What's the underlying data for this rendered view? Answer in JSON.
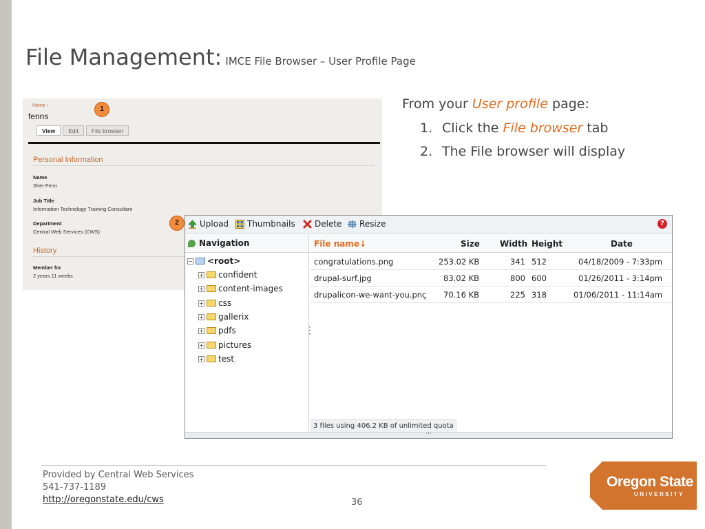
{
  "slide": {
    "title": "File Management:",
    "subtitle": "IMCE File Browser – User Profile Page",
    "page_number": "36"
  },
  "profile": {
    "breadcrumb": "Home ›",
    "username": "fenns",
    "tabs": [
      "View",
      "Edit",
      "File browser"
    ],
    "personal_heading": "Personal Information",
    "name_label": "Name",
    "name_value": "Sher Fenn",
    "job_label": "Job Title",
    "job_value": "Information Technology Training Consultant",
    "dept_label": "Department",
    "dept_value": "Central Web Services (CWS)",
    "history_heading": "History",
    "member_label": "Member for",
    "member_value": "2 years 11 weeks"
  },
  "callouts": [
    "1",
    "2"
  ],
  "instructions": {
    "lead_prefix": "From your",
    "lead_emphasis": "User profile",
    "lead_suffix": "page:",
    "steps": [
      {
        "num": "1.",
        "prefix": "Click the",
        "emphasis": "File browser",
        "suffix": "tab"
      },
      {
        "num": "2.",
        "text": "The File browser will display"
      }
    ],
    "emphasis_color": "#e36b1e"
  },
  "imce": {
    "toolbar": {
      "upload": "Upload",
      "thumbnails": "Thumbnails",
      "delete": "Delete",
      "resize": "Resize",
      "help": "?"
    },
    "navigation_label": "Navigation",
    "tree": {
      "root": "<root>",
      "folders": [
        "confident",
        "content-images",
        "css",
        "gallerix",
        "pdfs",
        "pictures",
        "test"
      ]
    },
    "columns": {
      "name": "File name↓",
      "size": "Size",
      "width": "Width",
      "height": "Height",
      "date": "Date"
    },
    "files": [
      {
        "name": "congratulations.png",
        "size": "253.02 KB",
        "width": "341",
        "height": "512",
        "date": "04/18/2009 - 7:33pm"
      },
      {
        "name": "drupal-surf.jpg",
        "size": "83.02 KB",
        "width": "800",
        "height": "600",
        "date": "01/26/2011 - 3:14pm"
      },
      {
        "name": "drupalicon-we-want-you.pnç",
        "size": "70.16 KB",
        "width": "225",
        "height": "318",
        "date": "01/06/2011 - 11:14am"
      }
    ],
    "status": "3 files using 406.2 KB of unlimited quota"
  },
  "footer": {
    "line1": "Provided by Central Web Services",
    "line2": "541-737-1189",
    "link": "http://oregonstate.edu/cws"
  },
  "logo": {
    "name": "Oregon State",
    "university": "UNIVERSITY",
    "color": "#d2732e"
  }
}
